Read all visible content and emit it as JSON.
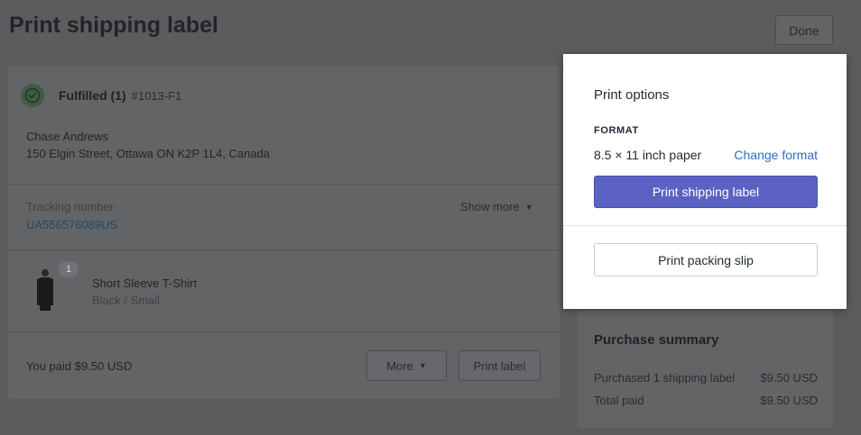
{
  "page": {
    "title": "Print shipping label",
    "done_label": "Done"
  },
  "fulfillment": {
    "status_label": "Fulfilled (1)",
    "order_number": "#1013-F1",
    "customer_name": "Chase Andrews",
    "customer_address": "150 Elgin Street, Ottawa ON K2P 1L4, Canada",
    "tracking_label": "Tracking number",
    "tracking_number": "UA556576089US",
    "show_more_label": "Show more",
    "product": {
      "quantity": "1",
      "name": "Short Sleeve T-Shirt",
      "variant": "Black / Small"
    },
    "paid_text": "You paid $9.50 USD",
    "more_label": "More",
    "print_label_label": "Print label"
  },
  "purchase_summary": {
    "title": "Purchase summary",
    "rows": [
      {
        "label": "Purchased 1 shipping label",
        "value": "$9.50 USD"
      },
      {
        "label": "Total paid",
        "value": "$9.50 USD"
      }
    ]
  },
  "print_options": {
    "title": "Print options",
    "format_label": "FORMAT",
    "format_value": "8.5 × 11 inch paper",
    "change_format_label": "Change format",
    "primary_button_label": "Print shipping label",
    "secondary_button_label": "Print packing slip"
  },
  "colors": {
    "primary_button": "#5c62c4",
    "link": "#2d6ebf",
    "overlay_background": "#5b5c5e"
  },
  "icons": [
    "check-circle-icon",
    "caret-down-icon",
    "tshirt-thumbnail"
  ]
}
